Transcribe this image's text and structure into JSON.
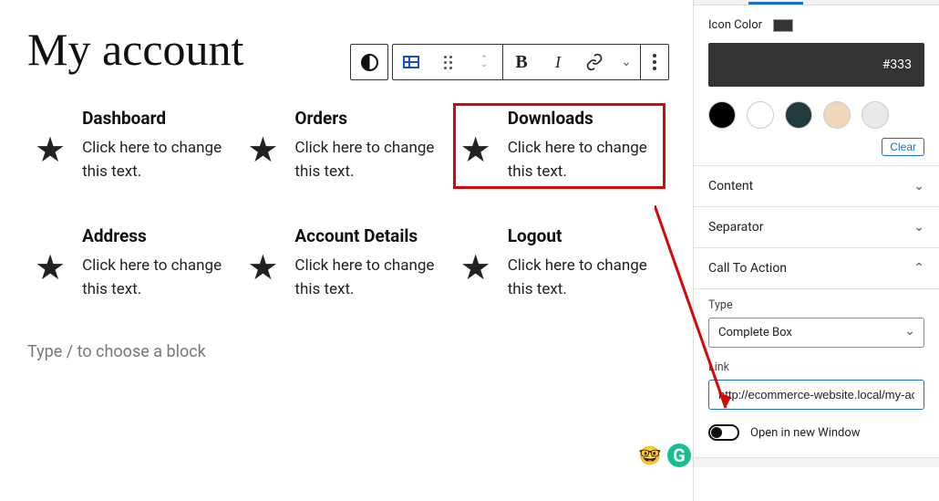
{
  "page_title": "My account",
  "toolbar": {
    "bold": "B",
    "italic": "I"
  },
  "cells": [
    {
      "title": "Dashboard",
      "desc": "Click here to change this text."
    },
    {
      "title": "Orders",
      "desc": "Click here to change this text."
    },
    {
      "title": "Downloads",
      "desc": "Click here to change this text."
    },
    {
      "title": "Address",
      "desc": "Click here to change this text."
    },
    {
      "title": "Account Details",
      "desc": "Click here to change this text."
    },
    {
      "title": "Logout",
      "desc": "Click here to change this text."
    }
  ],
  "placeholder": "Type / to choose a block",
  "sidebar": {
    "icon_color_label": "Icon Color",
    "hex": "#333",
    "palette": [
      "#000000",
      "#ffffff",
      "#1f3b3d",
      "#f0d6bb",
      "#e9e9e9"
    ],
    "clear": "Clear",
    "sections": {
      "content": "Content",
      "separator": "Separator",
      "cta": "Call To Action"
    },
    "type_label": "Type",
    "type_value": "Complete Box",
    "link_label": "Link",
    "link_value": "http://ecommerce-website.local/my-ac",
    "open_new": "Open in new Window"
  }
}
